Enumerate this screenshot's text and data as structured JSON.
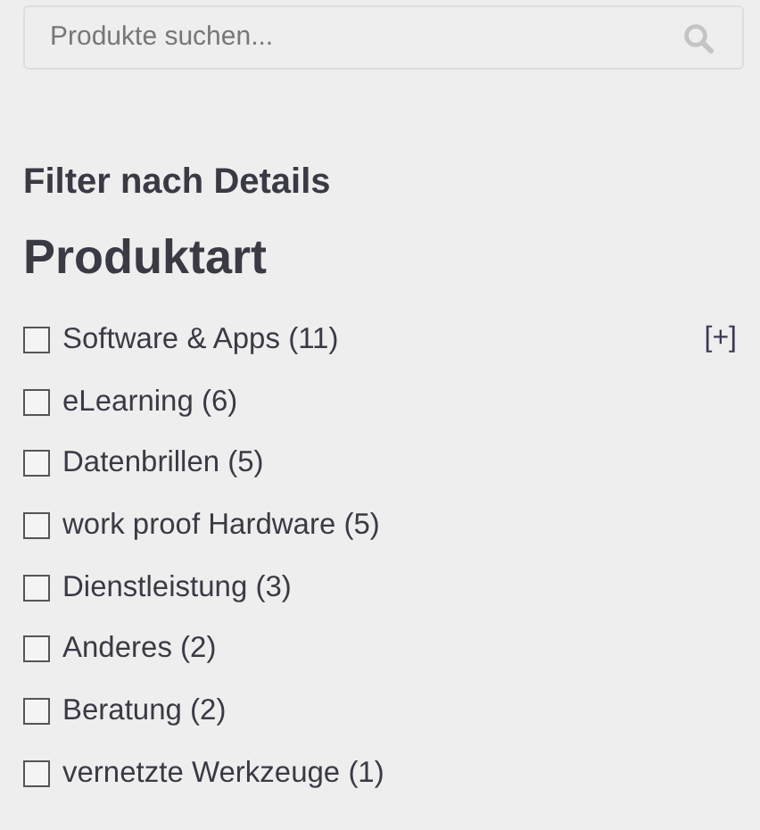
{
  "search": {
    "placeholder": "Produkte suchen..."
  },
  "filter_heading": "Filter nach Details",
  "section_title": "Produktart",
  "items": [
    {
      "label": "Software & Apps (11)",
      "checked": false,
      "expander": "[+]"
    },
    {
      "label": "eLearning (6)",
      "checked": false
    },
    {
      "label": "Datenbrillen (5)",
      "checked": false
    },
    {
      "label": "work proof Hardware (5)",
      "checked": false
    },
    {
      "label": "Dienstleistung (3)",
      "checked": false
    },
    {
      "label": "Anderes (2)",
      "checked": false
    },
    {
      "label": "Beratung (2)",
      "checked": false
    },
    {
      "label": "vernetzte Werkzeuge (1)",
      "checked": false
    }
  ]
}
